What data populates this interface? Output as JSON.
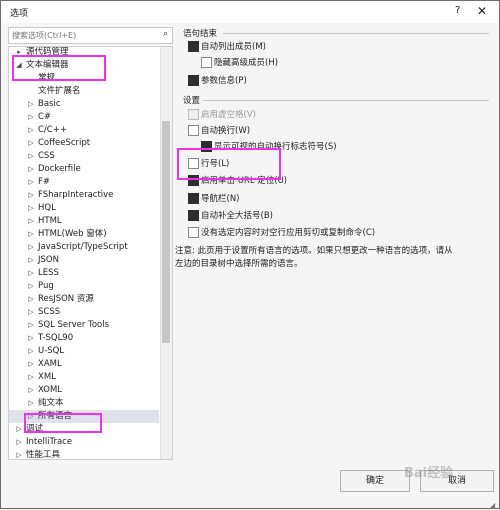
{
  "window": {
    "title": "选项",
    "help": "?",
    "close": "✕"
  },
  "search": {
    "placeholder": "搜索选项(Ctrl+E)"
  },
  "tree": {
    "items": [
      {
        "label": "源代码管理",
        "expander": "▸"
      },
      {
        "label": "文本编辑器",
        "expander": "◢"
      },
      {
        "label": "常规",
        "expander": ""
      },
      {
        "label": "文件扩展名",
        "expander": ""
      },
      {
        "label": "Basic",
        "expander": "▷"
      },
      {
        "label": "C#",
        "expander": "▷"
      },
      {
        "label": "C/C++",
        "expander": "▷"
      },
      {
        "label": "CoffeeScript",
        "expander": "▷"
      },
      {
        "label": "CSS",
        "expander": "▷"
      },
      {
        "label": "Dockerfile",
        "expander": "▷"
      },
      {
        "label": "F#",
        "expander": "▷"
      },
      {
        "label": "FSharpInteractive",
        "expander": "▷"
      },
      {
        "label": "HQL",
        "expander": "▷"
      },
      {
        "label": "HTML",
        "expander": "▷"
      },
      {
        "label": "HTML(Web 窗体)",
        "expander": "▷"
      },
      {
        "label": "JavaScript/TypeScript",
        "expander": "▷"
      },
      {
        "label": "JSON",
        "expander": "▷"
      },
      {
        "label": "LESS",
        "expander": "▷"
      },
      {
        "label": "Pug",
        "expander": "▷"
      },
      {
        "label": "ResJSON 资源",
        "expander": "▷"
      },
      {
        "label": "SCSS",
        "expander": "▷"
      },
      {
        "label": "SQL Server Tools",
        "expander": "▷"
      },
      {
        "label": "T-SQL90",
        "expander": "▷"
      },
      {
        "label": "U-SQL",
        "expander": "▷"
      },
      {
        "label": "XAML",
        "expander": "▷"
      },
      {
        "label": "XML",
        "expander": "▷"
      },
      {
        "label": "XOML",
        "expander": "▷"
      },
      {
        "label": "纯文本",
        "expander": "▷"
      },
      {
        "label": "所有语言",
        "expander": "▷"
      },
      {
        "label": "调试",
        "expander": "▷"
      },
      {
        "label": "IntelliTrace",
        "expander": "▷"
      },
      {
        "label": "性能工具",
        "expander": "▷"
      }
    ]
  },
  "statement_completion": {
    "title": "语句结束",
    "auto_list_members": "自动列出成员(M)",
    "hide_advanced_members": "隐藏高级成员(H)",
    "parameter_info": "参数信息(P)"
  },
  "settings": {
    "title": "设置",
    "enable_virtual_space": "启用虚空格(V)",
    "word_wrap": "自动换行(W)",
    "show_visual_glyphs": "显示可视的自动换行标志符号(S)",
    "line_numbers": "行号(L)",
    "enable_single_click_url": "启用单击 URL 定位(U)",
    "navigation_bar": "导航栏(N)",
    "auto_brace_completion": "自动补全大括号(B)",
    "apply_cut_copy": "没有选定内容时对空行应用剪切或复制命令(C)"
  },
  "note": "注意: 此页用于设置所有语言的选项。如果只想更改一种语言的选项，请从左边的目录树中选择所需的语言。",
  "buttons": {
    "ok": "确定",
    "cancel": "取消"
  },
  "watermark": "Bai经验",
  "corner": "◢"
}
